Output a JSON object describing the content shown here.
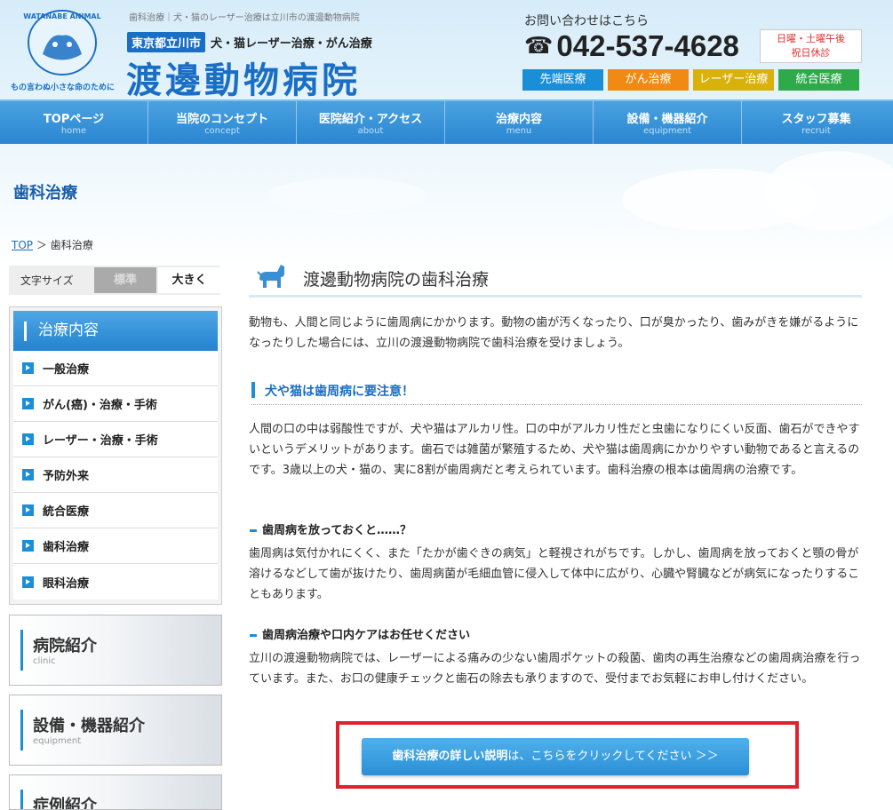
{
  "header": {
    "breadcrumb_top": "歯科治療｜犬・猫のレーザー治療は立川市の渡邊動物病院",
    "location_tag": "東京都立川市",
    "tagline": "犬・猫レーザー治療・がん治療",
    "site_title": "渡邊動物病院",
    "logo_text_top": "WATANABE ANIMAL HOSPITAL",
    "logo_text_bottom": "もの言わぬ小さな命のために",
    "contact_label": "お問い合わせはこちら",
    "phone": "042-537-4628",
    "holiday_line1": "日曜・土曜午後",
    "holiday_line2": "祝日休診",
    "tags": [
      {
        "label": "先端医療",
        "color": "#1a8fd8"
      },
      {
        "label": "がん治療",
        "color": "#f08a12"
      },
      {
        "label": "レーザー治療",
        "color": "#d9b10b"
      },
      {
        "label": "統合医療",
        "color": "#2eaa4a"
      }
    ]
  },
  "nav": [
    {
      "jp": "TOPページ",
      "en": "home"
    },
    {
      "jp": "当院のコンセプト",
      "en": "concept"
    },
    {
      "jp": "医院紹介・アクセス",
      "en": "about"
    },
    {
      "jp": "治療内容",
      "en": "menu"
    },
    {
      "jp": "設備・機器紹介",
      "en": "equipment"
    },
    {
      "jp": "スタッフ募集",
      "en": "recruit"
    }
  ],
  "page_heading": "歯科治療",
  "crumbs": {
    "home": "TOP",
    "sep": "＞",
    "current": "歯科治療"
  },
  "sidebar": {
    "fontsize_label": "文字サイズ",
    "fontsize_standard": "標準",
    "fontsize_large": "大きく",
    "menu_title": "治療内容",
    "menu_items": [
      "一般治療",
      "がん(癌)・治療・手術",
      "レーザー・治療・手術",
      "予防外来",
      "統合医療",
      "歯科治療",
      "眼科治療"
    ],
    "banners": [
      {
        "jp": "病院紹介",
        "en": "clinic"
      },
      {
        "jp": "設備・機器紹介",
        "en": "equipment"
      },
      {
        "jp": "症例紹介",
        "en": ""
      }
    ]
  },
  "main": {
    "title": "渡邊動物病院の歯科治療",
    "intro": "動物も、人間と同じように歯周病にかかります。動物の歯が汚くなったり、口が臭かったり、歯みがきを嫌がるようになったりした場合には、立川の渡邊動物病院で歯科治療を受けましょう。",
    "section_heading": "犬や猫は歯周病に要注意！",
    "section_text": "人間の口の中は弱酸性ですが、犬や猫はアルカリ性。口の中がアルカリ性だと虫歯になりにくい反面、歯石ができやすいというデメリットがあります。歯石では雑菌が繁殖するため、犬や猫は歯周病にかかりやすい動物であると言えるのです。3歳以上の犬・猫の、実に8割が歯周病だと考えられています。歯科治療の根本は歯周病の治療です。",
    "minor1_heading": "歯周病を放っておくと……？",
    "minor1_text": "歯周病は気付かれにくく、また「たかが歯ぐきの病気」と軽視されがちです。しかし、歯周病を放っておくと顎の骨が溶けるなどして歯が抜けたり、歯周病菌が毛細血管に侵入して体中に広がり、心臓や腎臓などが病気になったりすることもあります。",
    "minor2_heading": "歯周病治療や口内ケアはお任せください",
    "minor2_text": "立川の渡邊動物病院では、レーザーによる痛みの少ない歯周ポケットの殺菌、歯肉の再生治療などの歯周病治療を行っています。また、お口の健康チェックと歯石の除去も承りますので、受付までお気軽にお申し付けください。",
    "cta_bold": "歯科治療の詳しい説明",
    "cta_rest": "は、こちらをクリックしてください ＞＞"
  }
}
